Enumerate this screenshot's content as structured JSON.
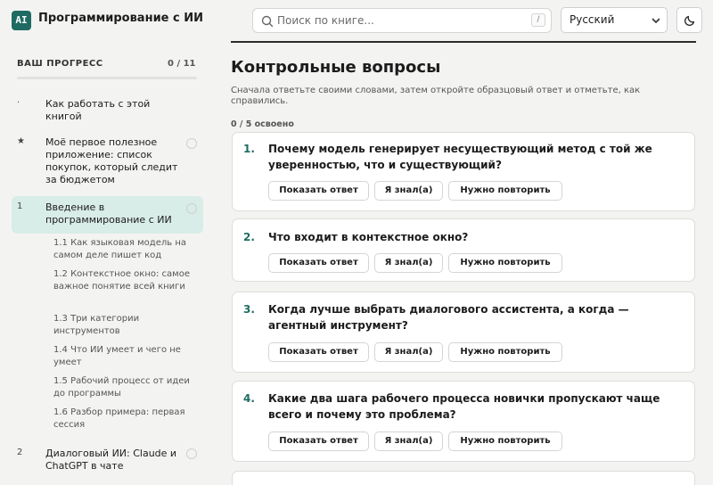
{
  "header": {
    "logo_text": "AI",
    "title": "Программирование с ИИ",
    "search_placeholder": "Поиск по книге...",
    "search_shortcut": "/",
    "language": "Русский",
    "theme_icon": "moon-icon"
  },
  "sidebar": {
    "progress_label": "ВАШ ПРОГРЕСС",
    "progress_count": "0 / 11",
    "progress_fraction": 0,
    "items": [
      {
        "num": "·",
        "label": "Как работать с этой книгой"
      },
      {
        "num": "★",
        "label": "Моё первое полезное приложение: список покупок, который следит за бюджетом"
      },
      {
        "num": "1",
        "label": "Введение в программирование с ИИ"
      },
      {
        "num": "2",
        "label": "Диалоговый ИИ: Claude и ChatGPT в чате"
      }
    ],
    "subitems": [
      "1.1  Как языковая модель на самом деле пишет код",
      "1.2  Контекстное окно: самое важное понятие всей книги",
      "1.3  Три категории инструментов",
      "1.4  Что ИИ умеет и чего не умеет",
      "1.5  Рабочий процесс от идеи до программы",
      "1.6  Разбор примера: первая сессия"
    ]
  },
  "main": {
    "heading": "Контрольные вопросы",
    "description": "Сначала ответьте своими словами, затем откройте образцовый ответ и отметьте, как справились.",
    "mastered": "0 / 5 освоено",
    "buttons": {
      "show": "Показать ответ",
      "knew": "Я знал(а)",
      "review": "Нужно повторить"
    },
    "questions": [
      {
        "num": "1.",
        "text": "Почему модель генерирует несуществующий метод с той же уверенностью, что и существующий?"
      },
      {
        "num": "2.",
        "text": "Что входит в контекстное окно?"
      },
      {
        "num": "3.",
        "text": "Когда лучше выбрать диалогового ассистента, а когда — агентный инструмент?"
      },
      {
        "num": "4.",
        "text": "Какие два шага рабочего процесса новички пропускают чаще всего и почему это проблема?"
      }
    ]
  },
  "colors": {
    "accent": "#1f6b63",
    "active_bg": "#d8ece8",
    "page_bg": "#f3f4f2"
  }
}
